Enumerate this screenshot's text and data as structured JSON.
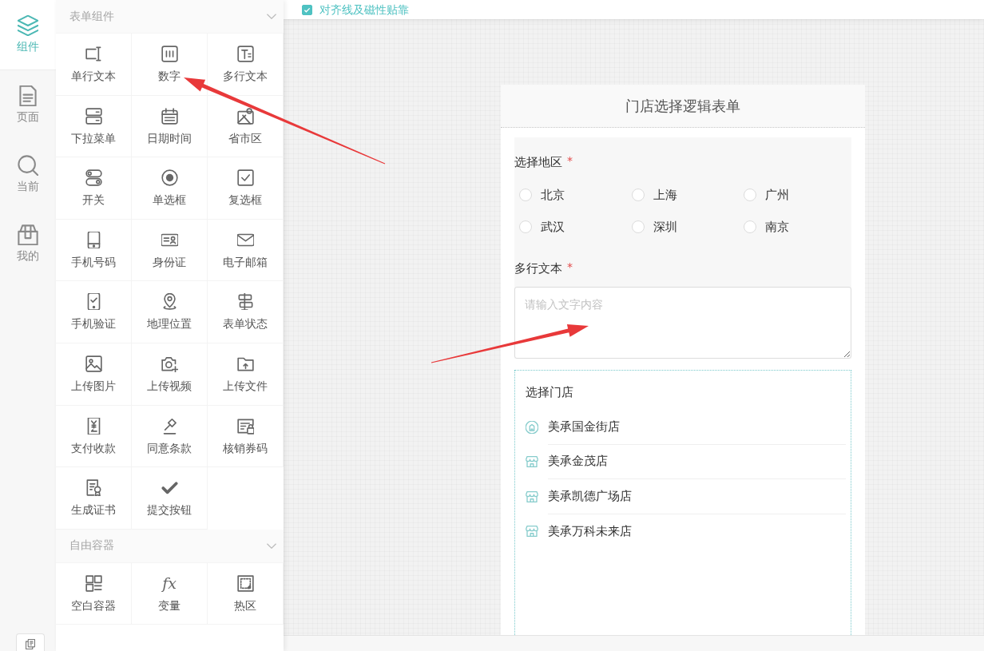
{
  "rail": [
    {
      "label": "组件",
      "selected": true
    },
    {
      "label": "页面",
      "selected": false
    },
    {
      "label": "当前",
      "selected": false
    },
    {
      "label": "我的",
      "selected": false
    }
  ],
  "palette": [
    {
      "title": "表单组件",
      "expanded": true,
      "items": [
        {
          "label": "单行文本"
        },
        {
          "label": "数字"
        },
        {
          "label": "多行文本"
        },
        {
          "label": "下拉菜单"
        },
        {
          "label": "日期时间"
        },
        {
          "label": "省市区"
        },
        {
          "label": "开关"
        },
        {
          "label": "单选框"
        },
        {
          "label": "复选框"
        },
        {
          "label": "手机号码"
        },
        {
          "label": "身份证"
        },
        {
          "label": "电子邮箱"
        },
        {
          "label": "手机验证"
        },
        {
          "label": "地理位置"
        },
        {
          "label": "表单状态"
        },
        {
          "label": "上传图片"
        },
        {
          "label": "上传视频"
        },
        {
          "label": "上传文件"
        },
        {
          "label": "支付收款"
        },
        {
          "label": "同意条款"
        },
        {
          "label": "核销券码"
        },
        {
          "label": "生成证书"
        },
        {
          "label": "提交按钮"
        }
      ]
    },
    {
      "title": "自由容器",
      "expanded": true,
      "items": [
        {
          "label": "空白容器"
        },
        {
          "label": "变量",
          "glyph": "fx"
        },
        {
          "label": "热区"
        }
      ]
    }
  ],
  "toolbar": {
    "snap_checkbox": {
      "label": "对齐线及磁性贴靠",
      "checked": true
    }
  },
  "form": {
    "title": "门店选择逻辑表单",
    "fields": [
      {
        "kind": "radio",
        "label": "选择地区",
        "required_mark": "*",
        "options": [
          {
            "label": "北京",
            "selected": false
          },
          {
            "label": "上海",
            "selected": false
          },
          {
            "label": "广州",
            "selected": false
          },
          {
            "label": "武汉",
            "selected": false
          },
          {
            "label": "深圳",
            "selected": false
          },
          {
            "label": "南京",
            "selected": false
          }
        ]
      },
      {
        "kind": "textarea",
        "label": "多行文本",
        "required_mark": "*",
        "placeholder": "请输入文字内容"
      },
      {
        "kind": "stores",
        "label": "选择门店",
        "stores": [
          {
            "name": "美承国金街店",
            "kind": "round"
          },
          {
            "name": "美承金茂店",
            "kind": "shop"
          },
          {
            "name": "美承凯德广场店",
            "kind": "shop"
          },
          {
            "name": "美承万科未来店",
            "kind": "shop"
          }
        ]
      }
    ]
  }
}
